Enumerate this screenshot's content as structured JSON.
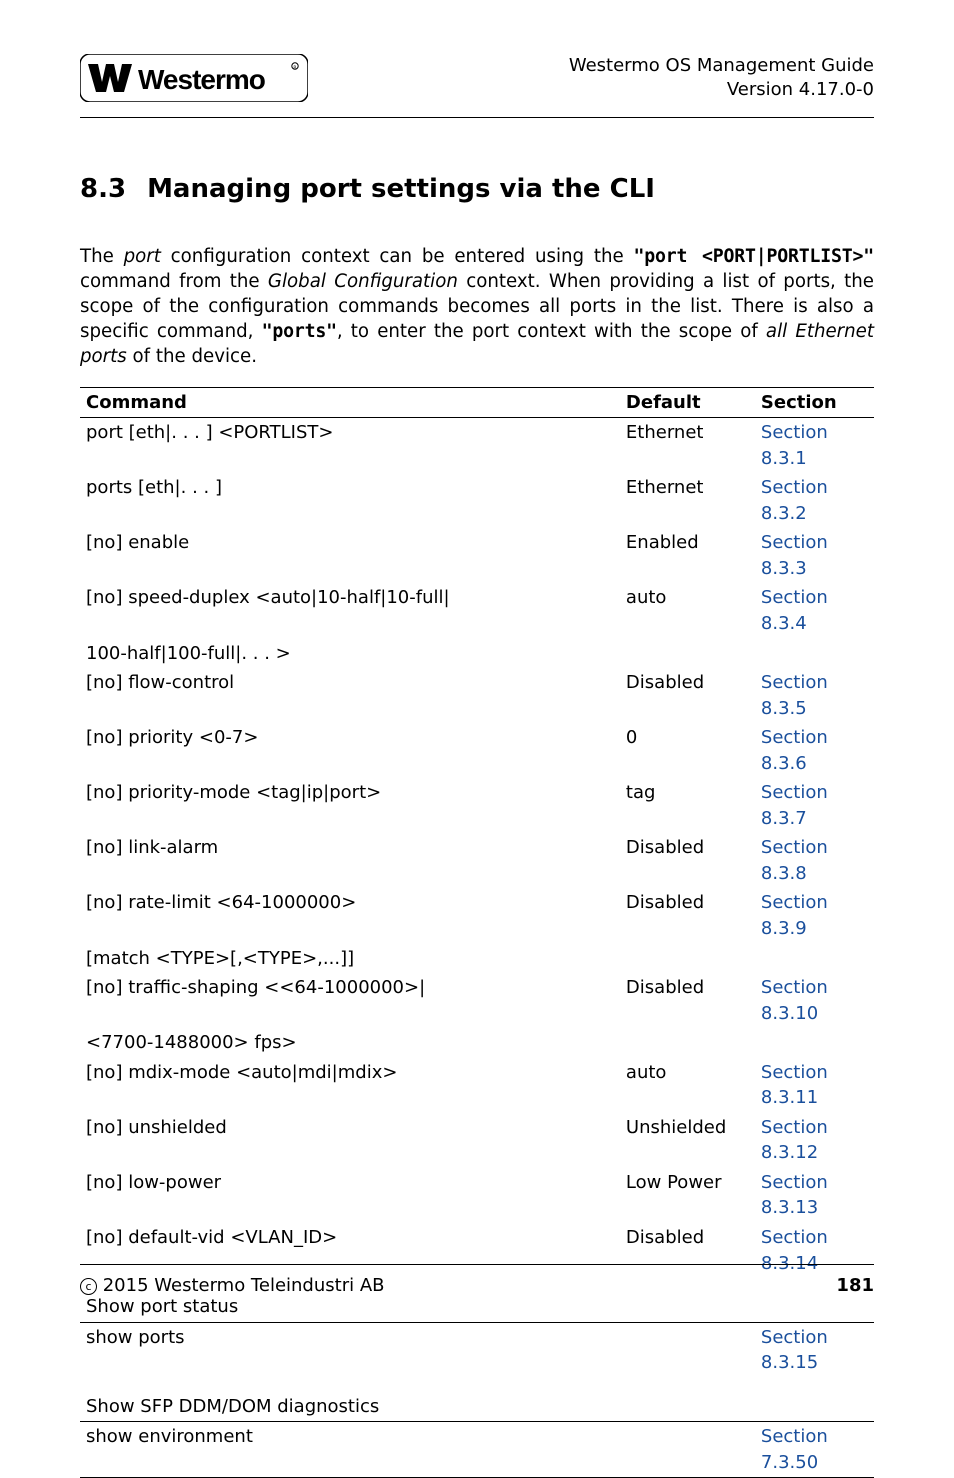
{
  "header": {
    "title_line1": "Westermo OS Management Guide",
    "title_line2": "Version 4.17.0-0"
  },
  "section": {
    "num": "8.3",
    "title": "Managing port settings via the CLI"
  },
  "paragraph": {
    "p1a": "The ",
    "p1b": "port",
    "p1c": " configuration context can be entered using the ",
    "p1d": "\"port <PORT|PORTLIST>\"",
    "p1e": " command from the ",
    "p1f": "Global Configuration",
    "p1g": " context. When providing a list of ports, the scope of the configuration commands becomes all ports in the list. There is also a specific command, ",
    "p1h": "\"ports\"",
    "p1i": ", to enter the port context with the scope of ",
    "p1j": "all Ethernet ports",
    "p1k": " of the device."
  },
  "table": {
    "headers": {
      "h1": "Command",
      "h2": "Default",
      "h3": "Section"
    },
    "rows": [
      {
        "cmd": "port [eth|. . . ] <PORTLIST>",
        "indent": 0,
        "def": "Ethernet",
        "sec": "Section 8.3.1"
      },
      {
        "cmd": "ports [eth|. . . ]",
        "indent": 0,
        "def": "Ethernet",
        "sec": "Section 8.3.2"
      },
      {
        "cmd": "[no] enable",
        "indent": 1,
        "def": "Enabled",
        "sec": "Section 8.3.3"
      },
      {
        "cmd": "[no] speed-duplex <auto|10-half|10-full|",
        "indent": 1,
        "def": "auto",
        "sec": "Section 8.3.4"
      },
      {
        "cmd": "100-half|100-full|. . . >",
        "indent": 2,
        "def": "",
        "sec": ""
      },
      {
        "cmd": "[no] flow-control",
        "indent": 1,
        "def": "Disabled",
        "sec": "Section 8.3.5"
      },
      {
        "cmd": "[no] priority <0-7>",
        "indent": 1,
        "def": "0",
        "sec": "Section 8.3.6"
      },
      {
        "cmd": "[no] priority-mode <tag|ip|port>",
        "indent": 1,
        "def": "tag",
        "sec": "Section 8.3.7"
      },
      {
        "cmd": "[no] link-alarm",
        "indent": 1,
        "def": "Disabled",
        "sec": "Section 8.3.8"
      },
      {
        "cmd": "[no] rate-limit <64-1000000>",
        "indent": 1,
        "def": "Disabled",
        "sec": "Section 8.3.9"
      },
      {
        "cmd": "[match <TYPE>[,<TYPE>,...]]",
        "indent": 3,
        "def": "",
        "sec": ""
      },
      {
        "cmd": "[no] traffic-shaping <<64-1000000>|",
        "indent": 1,
        "def": "Disabled",
        "sec": "Section 8.3.10"
      },
      {
        "cmd": "<7700-1488000> fps>",
        "indent": 2,
        "def": "",
        "sec": ""
      },
      {
        "cmd": "[no] mdix-mode <auto|mdi|mdix>",
        "indent": 1,
        "def": "auto",
        "sec": "Section 8.3.11"
      },
      {
        "cmd": "[no] unshielded",
        "indent": 1,
        "def": "Unshielded",
        "sec": "Section 8.3.12"
      },
      {
        "cmd": "[no] low-power",
        "indent": 1,
        "def": "Low Power",
        "sec": "Section 8.3.13"
      },
      {
        "cmd": "[no] default-vid <VLAN_ID>",
        "indent": 1,
        "def": "Disabled",
        "sec": "Section 8.3.14"
      }
    ],
    "sub1": {
      "label": "Show port status",
      "row": {
        "cmd": "show ports",
        "sec": "Section 8.3.15"
      }
    },
    "sub2": {
      "label": "Show SFP DDM/DOM diagnostics",
      "row": {
        "cmd": "show environment",
        "sec": "Section 7.3.50"
      }
    }
  },
  "footer": {
    "copyright": " 2015 Westermo Teleindustri AB",
    "page": "181"
  }
}
